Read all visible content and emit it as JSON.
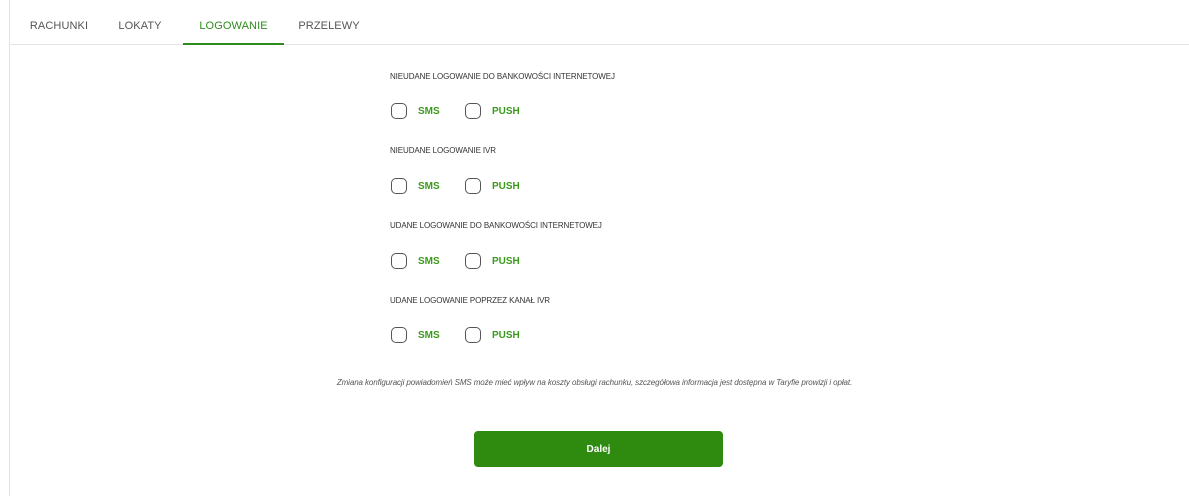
{
  "tabs": [
    {
      "label": "RACHUNKI",
      "active": false
    },
    {
      "label": "LOKATY",
      "active": false
    },
    {
      "label": "LOGOWANIE",
      "active": true
    },
    {
      "label": "PRZELEWY",
      "active": false
    }
  ],
  "sections": [
    {
      "title": "NIEUDANE LOGOWANIE DO BANKOWOŚCI INTERNETOWEJ",
      "options": [
        {
          "label": "SMS",
          "checked": false
        },
        {
          "label": "PUSH",
          "checked": false
        }
      ]
    },
    {
      "title": "NIEUDANE LOGOWANIE IVR",
      "options": [
        {
          "label": "SMS",
          "checked": false
        },
        {
          "label": "PUSH",
          "checked": false
        }
      ]
    },
    {
      "title": "UDANE LOGOWANIE DO BANKOWOŚCI INTERNETOWEJ",
      "options": [
        {
          "label": "SMS",
          "checked": false
        },
        {
          "label": "PUSH",
          "checked": false
        }
      ]
    },
    {
      "title": "UDANE LOGOWANIE POPRZEZ KANAŁ IVR",
      "options": [
        {
          "label": "SMS",
          "checked": false
        },
        {
          "label": "PUSH",
          "checked": false
        }
      ]
    }
  ],
  "note": "Zmiana konfiguracji powiadomień SMS może mieć wpływ na koszty obsługi rachunku, szczegółowa informacja jest dostępna w Taryfie prowizji i opłat.",
  "submit_label": "Dalej",
  "colors": {
    "accent": "#2e8b1e",
    "option_label": "#3a9a1a",
    "button": "#2e8b10"
  }
}
